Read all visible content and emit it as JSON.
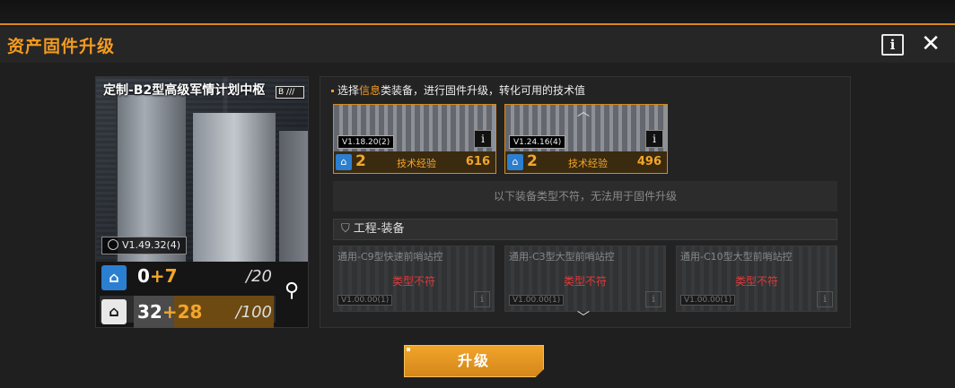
{
  "window": {
    "title": "资产固件升级",
    "info_icon": "info-icon",
    "close_icon": "close-icon"
  },
  "asset": {
    "name": "定制-B2型高级军情计划中枢",
    "badge": "B",
    "version": "V1.49.32(4)",
    "stats": [
      {
        "icon": "blueprint-icon",
        "base": "0",
        "add": "+7",
        "max": "/20"
      },
      {
        "icon": "tech-icon",
        "base": "32",
        "add": "+28",
        "max": "/100"
      }
    ],
    "search_icon": "magnifier-icon"
  },
  "instruction": {
    "prefix": "选择",
    "highlight": "信息",
    "suffix": "类装备，进行固件升级，转化可用的技术值"
  },
  "selected_equipment": [
    {
      "version": "V1.18.20(2)",
      "count": "2",
      "label": "技术经验",
      "value": "616"
    },
    {
      "version": "V1.24.16(4)",
      "count": "2",
      "label": "技术经验",
      "value": "496"
    }
  ],
  "notice": "以下装备类型不符，无法用于固件升级",
  "section": {
    "title": "工程-装备",
    "icon": "gear-shield-icon"
  },
  "locked_equipment": [
    {
      "name": "通用-C9型快速前哨站控",
      "status": "类型不符",
      "version": "V1.00.00(1)"
    },
    {
      "name": "通用-C3型大型前哨站控",
      "status": "类型不符",
      "version": "V1.00.00(1)"
    },
    {
      "name": "通用-C10型大型前哨站控",
      "status": "类型不符",
      "version": "V1.00.00(1)"
    }
  ],
  "upgrade_button": "升级",
  "colors": {
    "accent": "#f29b22",
    "blue": "#2b7fd0",
    "error": "#e03a3a"
  }
}
